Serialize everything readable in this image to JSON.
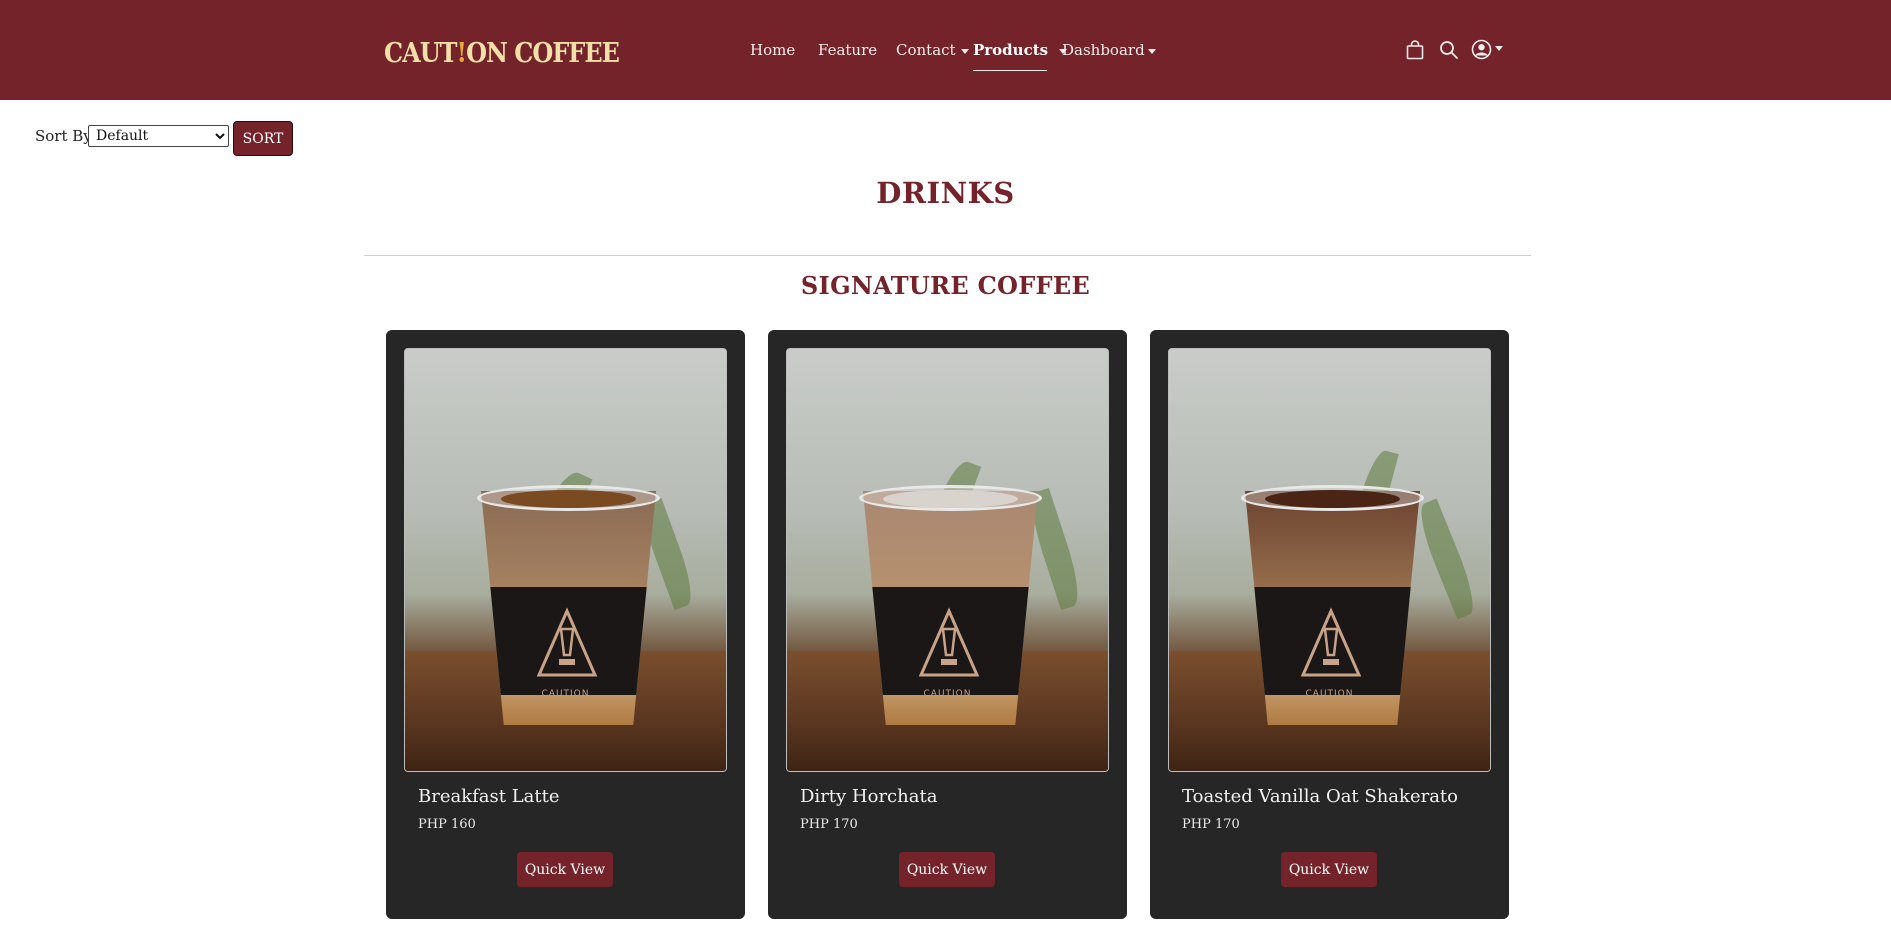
{
  "header": {
    "logo_left": "CAUT",
    "logo_bang": "!",
    "logo_right": "ON COFFEE",
    "nav": [
      {
        "label": "Home",
        "has_caret": false,
        "active": false
      },
      {
        "label": "Feature",
        "has_caret": false,
        "active": false
      },
      {
        "label": "Contact",
        "has_caret": true,
        "active": false
      },
      {
        "label": "Products",
        "has_caret": true,
        "active": true
      },
      {
        "label": "Dashboard",
        "has_caret": true,
        "active": false
      }
    ],
    "icons": [
      "shopping-bag-icon",
      "search-icon",
      "user-account-icon"
    ]
  },
  "sort": {
    "label": "Sort By:",
    "selected": "Default",
    "button_label": "SORT"
  },
  "page": {
    "title": "DRINKS",
    "section_title": "SIGNATURE COFFEE"
  },
  "products": [
    {
      "name": "Breakfast Latte",
      "price": "PHP 160",
      "button": "Quick View",
      "drink_color": "#8a6a55",
      "topping_color": "#7a4a22"
    },
    {
      "name": "Dirty Horchata",
      "price": "PHP 170",
      "button": "Quick View",
      "drink_color": "#a98772",
      "topping_color": "#d9d3cd"
    },
    {
      "name": "Toasted Vanilla Oat Shakerato",
      "price": "PHP 170",
      "button": "Quick View",
      "drink_color": "#6b4330",
      "topping_color": "#4a2414"
    }
  ],
  "colors": {
    "brand": "#74232a",
    "card": "#262626",
    "logo": "#f3dfa8"
  }
}
